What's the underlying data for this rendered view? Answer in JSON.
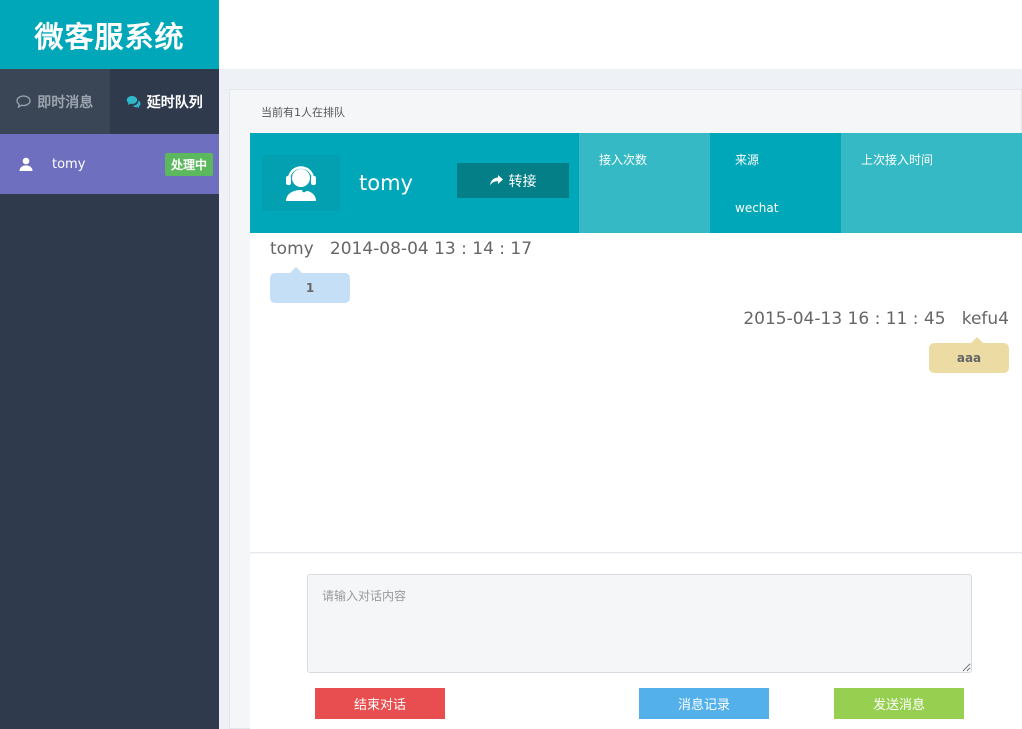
{
  "app": {
    "title": "微客服系统"
  },
  "sidebar": {
    "tabs": [
      {
        "label": "即时消息",
        "icon": "chat-bubble-outline-icon"
      },
      {
        "label": "延时队列",
        "icon": "chat-bubbles-icon"
      }
    ],
    "queue": [
      {
        "name": "tomy",
        "status": "处理中",
        "icon": "user-icon"
      }
    ]
  },
  "main": {
    "queue_info": "当前有1人在排队",
    "customer": {
      "name": "tomy",
      "transfer_label": "转接",
      "columns": [
        {
          "label": "接入次数",
          "value": ""
        },
        {
          "label": "来源",
          "value": "wechat"
        },
        {
          "label": "上次接入时间",
          "value": ""
        }
      ]
    },
    "messages": [
      {
        "meta": "tomy   2014-08-04 13 : 14 : 17",
        "text": "1",
        "side": "left"
      },
      {
        "meta": "2015-04-13 16 : 11 : 45   kefu4",
        "text": "aaa",
        "side": "right"
      }
    ],
    "input": {
      "placeholder": "请输入对话内容",
      "value": ""
    },
    "buttons": {
      "end": "结束对话",
      "history": "消息记录",
      "send": "发送消息"
    }
  },
  "colors": {
    "brand": "#00a7b8",
    "sidebar_bg": "#2f3a4d",
    "active_item": "#6f6fbf",
    "status_badge": "#5cb85c",
    "end_button": "#e84e4f",
    "history_button": "#53b0ea",
    "send_button": "#97cf51"
  }
}
